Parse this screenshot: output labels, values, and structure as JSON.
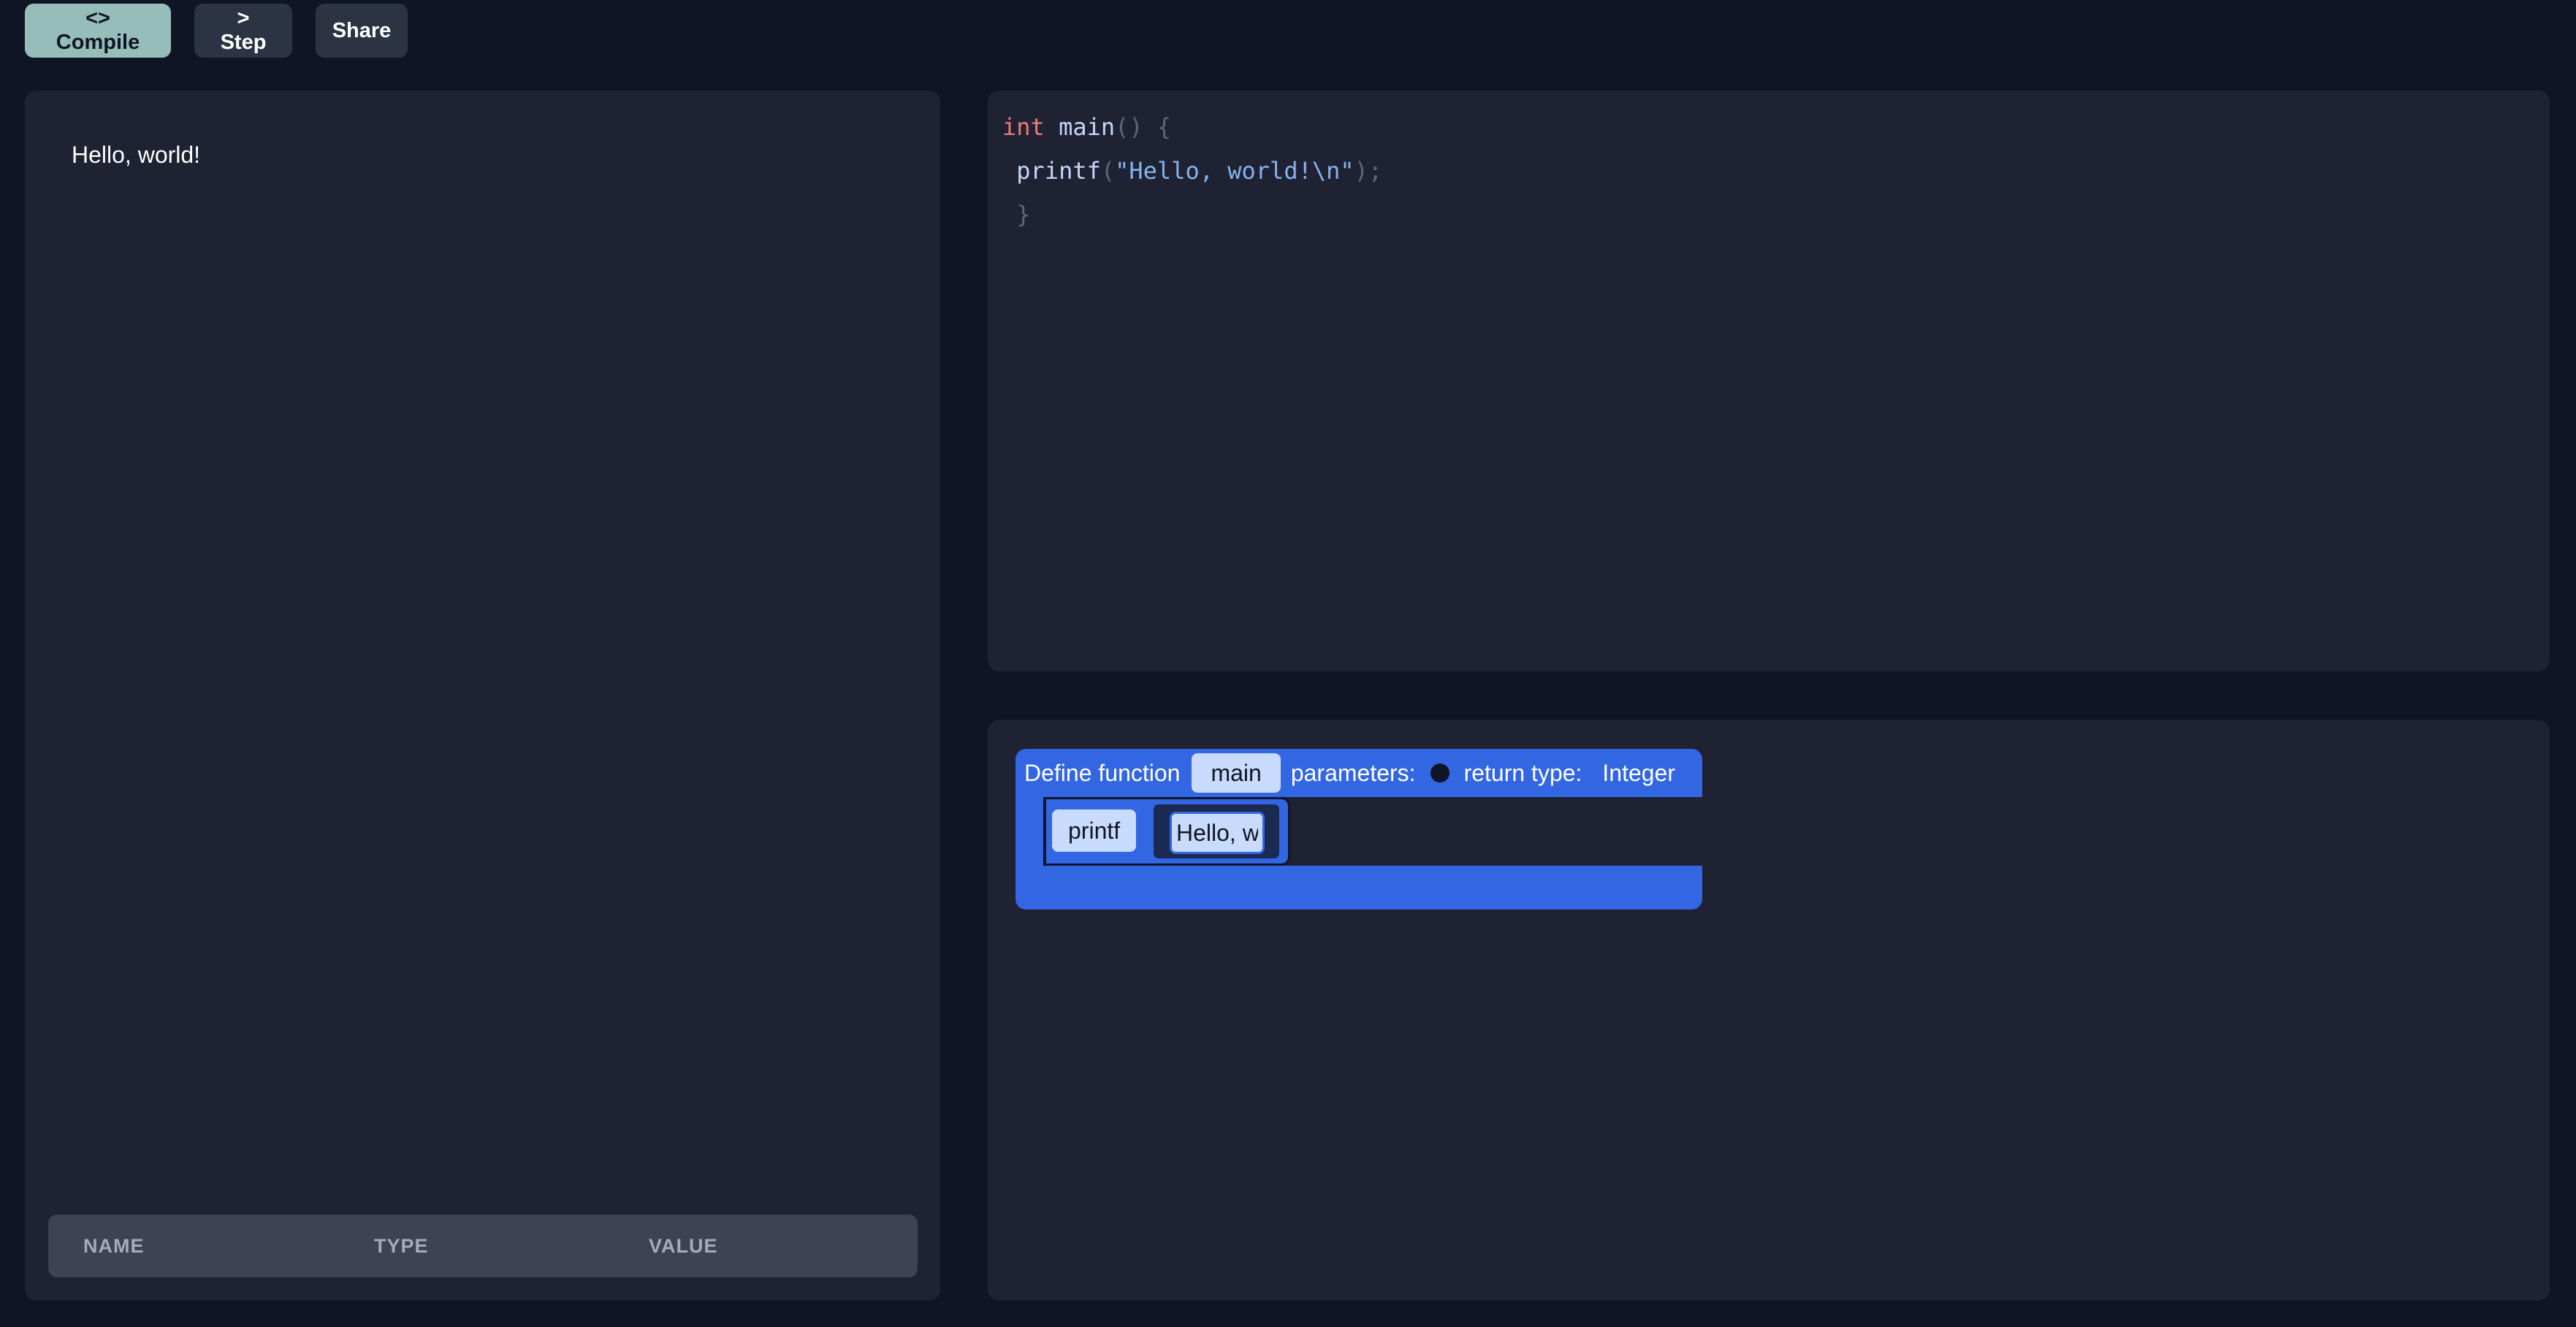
{
  "toolbar": {
    "compile_label": "<> Compile",
    "step_label": "> Step",
    "share_label": "Share"
  },
  "output": {
    "text": "Hello, world!"
  },
  "variables_table": {
    "columns": [
      "NAME",
      "TYPE",
      "VALUE"
    ]
  },
  "code": {
    "line1": {
      "kw": "int",
      "name": "main",
      "punc": "() {"
    },
    "line2": {
      "name": "printf",
      "open": "(",
      "str": "\"Hello, world!\\n\"",
      "close": ");"
    },
    "line3": {
      "punc": "}"
    }
  },
  "blocks": {
    "define_label": "Define function",
    "function_name": "main",
    "parameters_label": "parameters:",
    "return_type_label": "return type:",
    "return_type": "Integer",
    "call_name": "printf",
    "argument_value": "Hello, world!\\n"
  },
  "colors": {
    "background": "#0f1524",
    "panel": "#1e2232",
    "primary_button": "#97bdba",
    "block_blue": "#3266e3",
    "block_pill": "#c8dbfc",
    "keyword": "#ef7b72",
    "string": "#84b3ef"
  }
}
